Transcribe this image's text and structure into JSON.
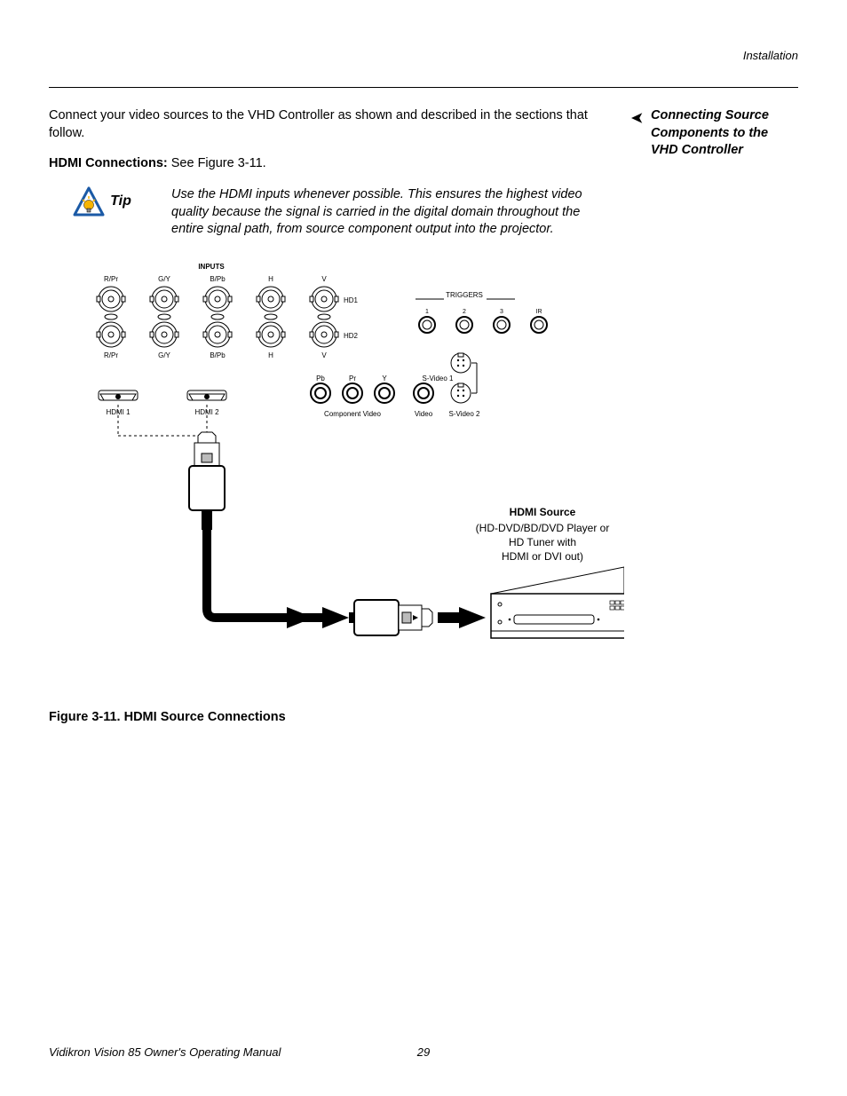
{
  "header": {
    "section": "Installation"
  },
  "intro": "Connect your video sources to the VHD Controller as shown and described in the sections that follow.",
  "hdmi_line": {
    "bold": "HDMI Connections: ",
    "rest": "See Figure 3-11."
  },
  "sidebar": {
    "arrow": "➤",
    "title": "Connecting Source Components to the VHD Controller"
  },
  "tip": {
    "label": "Tip",
    "text": "Use the HDMI inputs whenever possible. This ensures the highest video quality because the signal is carried in the digital domain throughout the entire signal path, from source component output into the projector."
  },
  "diagram": {
    "inputs_label": "INPUTS",
    "row_top": [
      "R/Pr",
      "G/Y",
      "B/Pb",
      "H",
      "V"
    ],
    "hd_rows": [
      "HD1",
      "HD2"
    ],
    "row_bottom": [
      "R/Pr",
      "G/Y",
      "B/Pb",
      "H",
      "V"
    ],
    "triggers": {
      "label": "TRIGGERS",
      "nums": [
        "1",
        "2",
        "3"
      ],
      "ir": "IR"
    },
    "comp_top": [
      "Pb",
      "Pr",
      "Y"
    ],
    "svideo1": "S-Video 1",
    "comp_bottom": "Component Video",
    "video": "Video",
    "svideo2": "S-Video 2",
    "hdmi_ports": [
      "HDMI 1",
      "HDMI 2"
    ],
    "source": {
      "title": "HDMI Source",
      "line1": "(HD-DVD/BD/DVD Player or",
      "line2": "HD Tuner with",
      "line3": "HDMI or DVI out)"
    }
  },
  "figure_caption": "Figure 3-11. HDMI Source Connections",
  "footer": {
    "title": "Vidikron Vision 85 Owner's Operating Manual",
    "page": "29"
  }
}
